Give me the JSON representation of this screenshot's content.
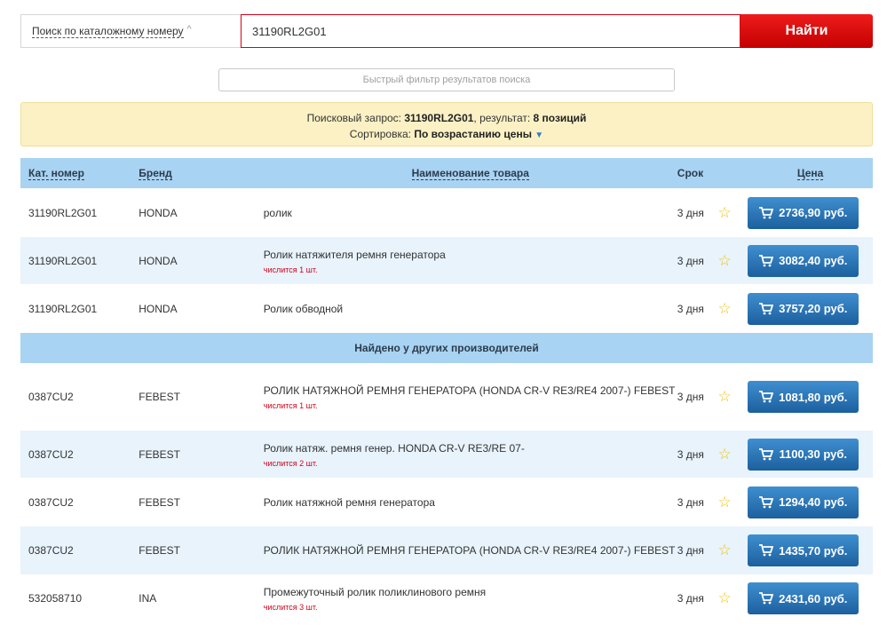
{
  "search": {
    "type_label": "Поиск по каталожному номеру",
    "query": "31190RL2G01",
    "button": "Найти"
  },
  "filter": {
    "placeholder": "Быстрый фильтр результатов поиска"
  },
  "info": {
    "query_prefix": "Поисковый запрос: ",
    "query": "31190RL2G01",
    "result_prefix": ", результат: ",
    "result": "8 позиций",
    "sort_prefix": "Сортировка: ",
    "sort_value": "По возрастанию цены"
  },
  "table": {
    "headers": {
      "num": "Кат. номер",
      "brand": "Бренд",
      "name": "Наименование товара",
      "term": "Срок",
      "price": "Цена"
    },
    "rows": [
      {
        "num": "31190RL2G01",
        "brand": "HONDA",
        "name": "ролик",
        "note": "",
        "term": "3 дня",
        "price": "2736,90 руб."
      },
      {
        "num": "31190RL2G01",
        "brand": "HONDA",
        "name": "Ролик натяжителя ремня генератора",
        "note": "числится 1 шт.",
        "term": "3 дня",
        "price": "3082,40 руб."
      },
      {
        "num": "31190RL2G01",
        "brand": "HONDA",
        "name": "Ролик обводной",
        "note": "",
        "term": "3 дня",
        "price": "3757,20 руб."
      }
    ],
    "section_title": "Найдено у других производителей",
    "other_rows": [
      {
        "num": "0387CU2",
        "brand": "FEBEST",
        "name": "РОЛИК НАТЯЖНОЙ РЕМНЯ ГЕНЕРАТОРА (HONDA CR-V RE3/RE4 2007-) FEBEST",
        "note": "числится 1 шт.",
        "term": "3 дня",
        "price": "1081,80 руб."
      },
      {
        "num": "0387CU2",
        "brand": "FEBEST",
        "name": "Ролик натяж. ремня генер. HONDA CR-V RE3/RE 07-",
        "note": "числится 2 шт.",
        "term": "3 дня",
        "price": "1100,30 руб."
      },
      {
        "num": "0387CU2",
        "brand": "FEBEST",
        "name": "Ролик натяжной ремня генератора",
        "note": "",
        "term": "3 дня",
        "price": "1294,40 руб."
      },
      {
        "num": "0387CU2",
        "brand": "FEBEST",
        "name": "РОЛИК НАТЯЖНОЙ РЕМНЯ ГЕНЕРАТОРА (HONDA CR-V RE3/RE4 2007-) FEBEST",
        "note": "",
        "term": "3 дня",
        "price": "1435,70 руб."
      },
      {
        "num": "532058710",
        "brand": "INA",
        "name": "Промежуточный ролик поликлинового ремня",
        "note": "числится 3 шт.",
        "term": "3 дня",
        "price": "2431,60 руб."
      }
    ]
  },
  "colors": {
    "accent_red": "#d0021b",
    "header_blue": "#a9d3f2",
    "price_button": "#2a72b5",
    "info_bg": "#fbf1c4"
  }
}
